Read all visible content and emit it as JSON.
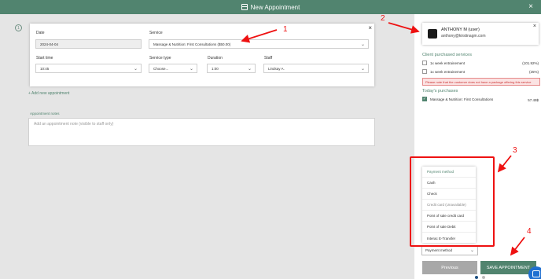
{
  "header": {
    "title": "New Appointment",
    "close": "×"
  },
  "form": {
    "step": "1",
    "close": "×",
    "date_label": "Date",
    "date_value": "2024-04-04",
    "service_label": "Service",
    "service_value": "Massage & Nutrition: First Consultations ($50.00)",
    "start_time_label": "Start time",
    "start_time_value": "10:45",
    "service_type_label": "Service type",
    "service_type_value": "Choose...",
    "duration_label": "Duration",
    "duration_value": "1:00",
    "staff_label": "Staff",
    "staff_value": "Lindsay A.",
    "add_new": "+ Add new appointment",
    "notes_label": "Appointment notes",
    "notes_placeholder": "Add an appointment note (visible to staff only)"
  },
  "client": {
    "name": "ANTHONY M (user)",
    "email": "anthony@kirstinagm.com",
    "close": "×"
  },
  "packages": {
    "title": "Client purchased services",
    "items": [
      {
        "label": "1x week entrainement",
        "value": "(101.92%)"
      },
      {
        "label": "1x week entrainement",
        "value": "(25%)"
      }
    ],
    "warning": "Please note that the customer does not have a package offering this service"
  },
  "today": {
    "title": "Today's purchases",
    "item": {
      "label": "Massage & Nutrition: First Consultations",
      "price": "57.49$",
      "checked": true
    }
  },
  "payment": {
    "options": [
      "Payment method",
      "Cash",
      "Check",
      "Credit card (Unavailable)",
      "Point of sale credit card",
      "Point of sale Debit",
      "Interac E-Transfer"
    ],
    "selected": "Payment method"
  },
  "buttons": {
    "previous": "Previous",
    "save": "SAVE APPOINTMENT"
  },
  "annotations": [
    "1",
    "2",
    "3",
    "4"
  ],
  "colors": {
    "brand": "#51846f",
    "annotation": "#ee1111",
    "warning_bg": "#fbe3e3"
  }
}
